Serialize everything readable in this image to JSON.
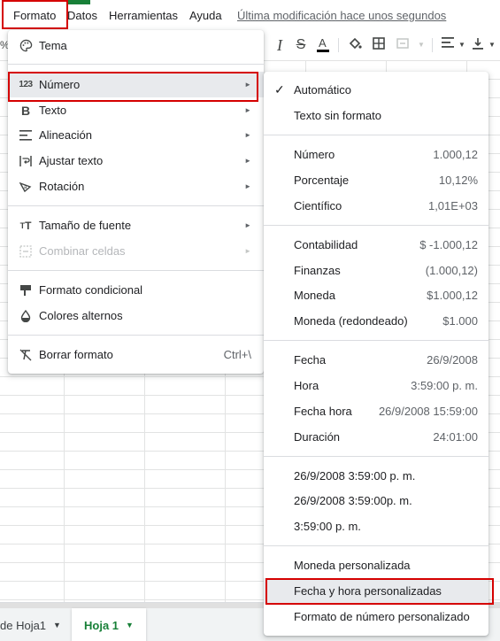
{
  "menubar": {
    "items": [
      "Formato",
      "Datos",
      "Herramientas",
      "Ayuda"
    ],
    "last_modified": "Última modificación hace unos segundos"
  },
  "toolbar": {
    "left_glyph": "%",
    "icons": [
      "italic-icon",
      "strikethrough-icon",
      "text-color-icon",
      "fill-color-icon",
      "borders-icon",
      "merge-cells-icon",
      "horizontal-align-icon",
      "vertical-align-icon"
    ]
  },
  "format_menu": {
    "items": [
      {
        "label": "Tema",
        "icon": "palette-icon"
      },
      {
        "label": "Número",
        "icon": "123-icon"
      },
      {
        "label": "Texto",
        "icon": "bold-icon"
      },
      {
        "label": "Alineación",
        "icon": "align-icon"
      },
      {
        "label": "Ajustar texto",
        "icon": "wrap-icon"
      },
      {
        "label": "Rotación",
        "icon": "rotation-icon"
      },
      {
        "label": "Tamaño de fuente",
        "icon": "font-size-icon"
      },
      {
        "label": "Combinar celdas",
        "icon": "merge-icon"
      },
      {
        "label": "Formato condicional",
        "icon": "conditional-format-icon"
      },
      {
        "label": "Colores alternos",
        "icon": "drop-icon"
      },
      {
        "label": "Borrar formato",
        "icon": "clear-format-icon",
        "shortcut": "Ctrl+\\"
      }
    ]
  },
  "number_submenu": {
    "items": [
      {
        "label": "Automático",
        "value": ""
      },
      {
        "label": "Texto sin formato",
        "value": ""
      },
      {
        "label": "Número",
        "value": "1.000,12"
      },
      {
        "label": "Porcentaje",
        "value": "10,12%"
      },
      {
        "label": "Científico",
        "value": "1,01E+03"
      },
      {
        "label": "Contabilidad",
        "value": "$ -1.000,12"
      },
      {
        "label": "Finanzas",
        "value": "(1.000,12)"
      },
      {
        "label": "Moneda",
        "value": "$1.000,12"
      },
      {
        "label": "Moneda (redondeado)",
        "value": "$1.000"
      },
      {
        "label": "Fecha",
        "value": "26/9/2008"
      },
      {
        "label": "Hora",
        "value": "3:59:00 p. m."
      },
      {
        "label": "Fecha hora",
        "value": "26/9/2008 15:59:00"
      },
      {
        "label": "Duración",
        "value": "24:01:00"
      },
      {
        "label": "26/9/2008 3:59:00 p. m.",
        "value": ""
      },
      {
        "label": "26/9/2008 3:59:00p. m.",
        "value": ""
      },
      {
        "label": "3:59:00 p. m.",
        "value": ""
      },
      {
        "label": "Moneda personalizada",
        "value": ""
      },
      {
        "label": "Fecha y hora personalizadas",
        "value": ""
      },
      {
        "label": "Formato de número personalizado",
        "value": ""
      }
    ]
  },
  "sheets": {
    "tabs": [
      "de Hoja1",
      "Hoja 1"
    ]
  },
  "colors": {
    "highlight": "#d50000",
    "active_sheet": "#188038"
  }
}
